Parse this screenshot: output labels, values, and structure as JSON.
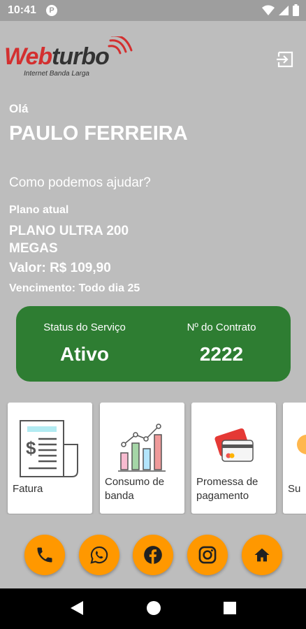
{
  "status_bar": {
    "time": "10:41",
    "notification_icon": "p-icon",
    "icons": [
      "wifi-icon",
      "signal-icon",
      "battery-icon"
    ]
  },
  "header": {
    "logo_text": "Webturbo",
    "logo_tagline": "Internet Banda Larga",
    "logout_icon": "logout-icon"
  },
  "greeting": {
    "hello": "Olá",
    "user_name": "PAULO FERREIRA",
    "help": "Como podemos ajudar?"
  },
  "plan": {
    "label": "Plano atual",
    "name": "PLANO ULTRA 200 MEGAS",
    "value": "Valor: R$ 109,90",
    "due": "Vencimento: Todo dia 25"
  },
  "service": {
    "status_label": "Status do Serviço",
    "status_value": "Ativo",
    "contract_label": "Nº do Contrato",
    "contract_value": "2222"
  },
  "menu_cards": [
    {
      "label": "Fatura",
      "icon": "invoice-icon"
    },
    {
      "label": "Consumo de banda",
      "icon": "bar-chart-icon"
    },
    {
      "label": "Promessa de pagamento",
      "icon": "credit-card-icon"
    },
    {
      "label": "Su",
      "icon": "support-icon"
    }
  ],
  "quick_actions": [
    {
      "icon": "phone-icon"
    },
    {
      "icon": "whatsapp-icon"
    },
    {
      "icon": "facebook-icon"
    },
    {
      "icon": "instagram-icon"
    },
    {
      "icon": "home-icon"
    }
  ],
  "colors": {
    "background": "#bdbdbd",
    "status_card": "#2e7d32",
    "action_button": "#ff9800",
    "logo_red": "#d32f2f"
  }
}
